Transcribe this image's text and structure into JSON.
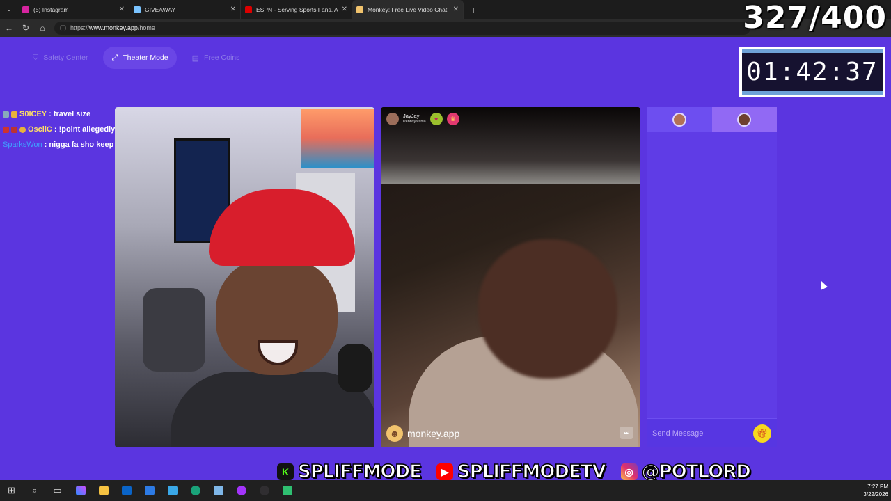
{
  "browser": {
    "tabs": [
      {
        "title": "(5) Instagram",
        "color": "#d6249f",
        "active": false
      },
      {
        "title": "GIVEAWAY",
        "color": "#7ac3ff",
        "active": false
      },
      {
        "title": "ESPN - Serving Sports Fans. Anytime...",
        "color": "#d00",
        "active": false
      },
      {
        "title": "Monkey: Free Live Video Chat",
        "color": "#f1c36d",
        "active": true
      }
    ],
    "url_prefix": "https://",
    "url_host": "www.monkey.app",
    "url_path": "/home"
  },
  "overlay": {
    "counter": "327/400",
    "timer": "01:42:37"
  },
  "toolbar": {
    "safety_center": "Safety Center",
    "theater_mode": "Theater Mode",
    "free_coins": "Free Coins"
  },
  "chat": [
    {
      "user": "S0ICEY",
      "message": ": travel size",
      "user_color": "yellow"
    },
    {
      "user": "OsciiC",
      "message": ": !point allegedly it's used to slide in the opps",
      "user_color": "yellow"
    },
    {
      "user": "SparksWon",
      "message": ": nigga fa sho keep baby oil on em",
      "user_color": "blue"
    }
  ],
  "peer": {
    "name": "JayJay",
    "location": "Pennsylvania"
  },
  "watermark": "monkey.app",
  "sidepanel": {
    "message_placeholder": "Send Message"
  },
  "socials": [
    {
      "name": "SPLIFFMODE",
      "icon": "kick-icon"
    },
    {
      "name": "SPLIFFMODETV",
      "icon": "youtube-icon"
    },
    {
      "name": "@POTLORD",
      "icon": "instagram-icon"
    }
  ],
  "taskbar": {
    "time": "7:27 PM",
    "date": "3/22/2026"
  }
}
